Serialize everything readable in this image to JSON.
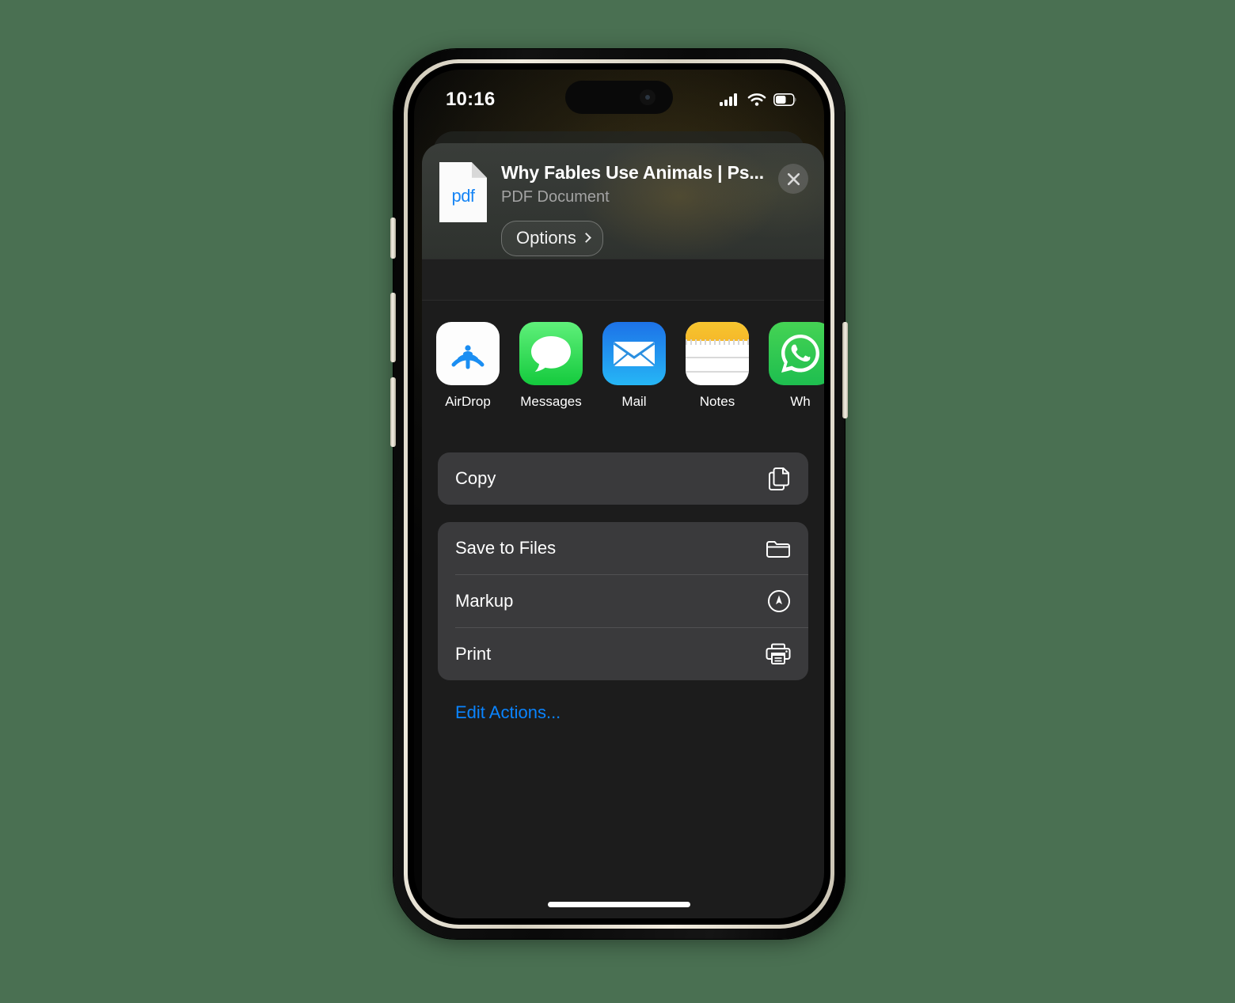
{
  "statusbar": {
    "time": "10:16",
    "cellular_icon": "cellular-signal-icon",
    "wifi_icon": "wifi-icon",
    "battery_icon": "battery-icon",
    "battery_level_pct": 55
  },
  "sheet": {
    "document": {
      "file_type_badge": "pdf",
      "title": "Why Fables Use Animals | Ps...",
      "subtitle": "PDF Document",
      "icon": "pdf-document-icon"
    },
    "options_button": {
      "label": "Options",
      "chevron_icon": "chevron-right-icon"
    },
    "close_button": {
      "icon": "close-icon"
    },
    "apps": [
      {
        "name": "AirDrop",
        "icon": "airdrop-icon"
      },
      {
        "name": "Messages",
        "icon": "messages-icon"
      },
      {
        "name": "Mail",
        "icon": "mail-icon"
      },
      {
        "name": "Notes",
        "icon": "notes-icon"
      },
      {
        "name": "Wh",
        "icon": "whatsapp-icon"
      }
    ],
    "action_groups": [
      {
        "rows": [
          {
            "label": "Copy",
            "icon": "copy-documents-icon"
          }
        ]
      },
      {
        "rows": [
          {
            "label": "Save to Files",
            "icon": "folder-icon"
          },
          {
            "label": "Markup",
            "icon": "markup-pen-icon"
          },
          {
            "label": "Print",
            "icon": "printer-icon"
          }
        ]
      }
    ],
    "edit_actions_label": "Edit Actions..."
  },
  "colors": {
    "page_background": "#4a7052",
    "sheet_background": "#1c1c1c",
    "list_row_background": "#3a3a3c",
    "accent_blue": "#0a84ff",
    "pdf_blue": "#1785f5",
    "notes_yellow": "#f7c52e",
    "messages_green": "#14ca3d",
    "mail_blue": "#1d72e8",
    "whatsapp_green": "#1ebe4f"
  }
}
